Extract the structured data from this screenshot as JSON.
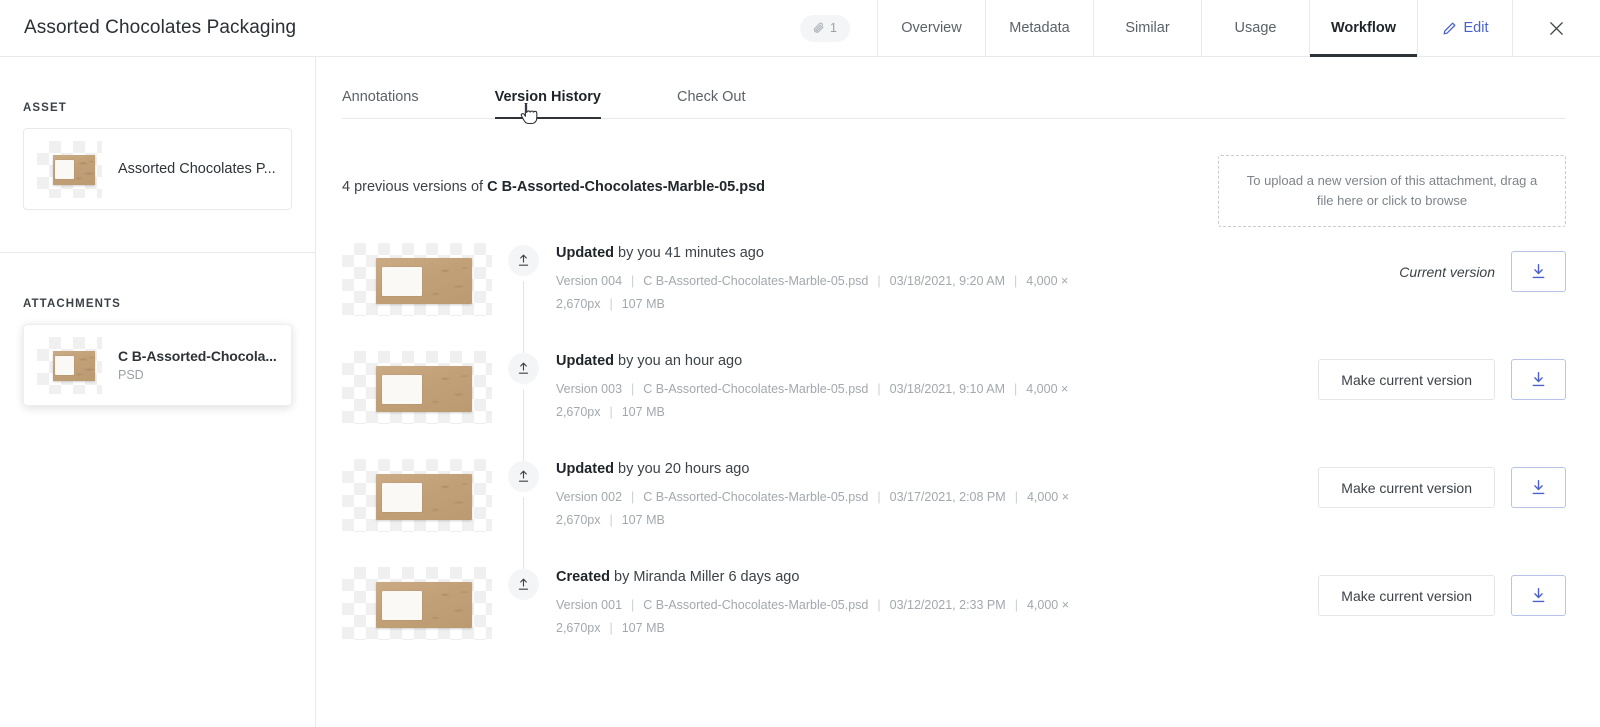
{
  "header": {
    "title": "Assorted Chocolates Packaging",
    "attachment_badge": {
      "icon": "paperclip-icon",
      "count": "1"
    },
    "tabs": [
      {
        "id": "overview",
        "label": "Overview",
        "active": false
      },
      {
        "id": "metadata",
        "label": "Metadata",
        "active": false
      },
      {
        "id": "similar",
        "label": "Similar",
        "active": false
      },
      {
        "id": "usage",
        "label": "Usage",
        "active": false
      },
      {
        "id": "workflow",
        "label": "Workflow",
        "active": true
      }
    ],
    "edit": {
      "label": "Edit",
      "icon": "pencil-icon",
      "color": "#4b63c9"
    },
    "close": {
      "icon": "close-icon"
    }
  },
  "sidebar": {
    "asset_label": "ASSET",
    "asset": {
      "name": "Assorted Chocolates P...",
      "thumbnail": "chocolate-bar-thumbnail"
    },
    "attachments_label": "ATTACHMENTS",
    "attachments": [
      {
        "name": "C B-Assorted-Chocola...",
        "type": "PSD",
        "selected": true,
        "thumbnail": "chocolate-bar-thumbnail"
      }
    ]
  },
  "main": {
    "subtabs": [
      {
        "id": "annotations",
        "label": "Annotations",
        "active": false
      },
      {
        "id": "version-history",
        "label": "Version History",
        "active": true
      },
      {
        "id": "check-out",
        "label": "Check Out",
        "active": false
      }
    ],
    "summary": {
      "prefix": "4 previous versions of ",
      "filename": "C B-Assorted-Chocolates-Marble-05.psd"
    },
    "dropzone": {
      "text": "To upload a new version of this attachment, drag a file here or click to browse"
    },
    "versions": [
      {
        "action": "Updated",
        "by": " by you 41 minutes ago",
        "version": "Version 004",
        "filename": "C B-Assorted-Chocolates-Marble-05.psd",
        "date": "03/18/2021, 9:20 AM",
        "dimensions": "4,000 × 2,670px",
        "size": "107 MB",
        "is_current": true,
        "status_label": "Current version",
        "download_label": "download-icon"
      },
      {
        "action": "Updated",
        "by": " by you an hour ago",
        "version": "Version 003",
        "filename": "C B-Assorted-Chocolates-Marble-05.psd",
        "date": "03/18/2021, 9:10 AM",
        "dimensions": "4,000 × 2,670px",
        "size": "107 MB",
        "is_current": false,
        "status_label": "Make current version",
        "download_label": "download-icon"
      },
      {
        "action": "Updated",
        "by": " by you 20 hours ago",
        "version": "Version 002",
        "filename": "C B-Assorted-Chocolates-Marble-05.psd",
        "date": "03/17/2021, 2:08 PM",
        "dimensions": "4,000 × 2,670px",
        "size": "107 MB",
        "is_current": false,
        "status_label": "Make current version",
        "download_label": "download-icon"
      },
      {
        "action": "Created",
        "by": " by Miranda Miller 6 days ago",
        "version": "Version 001",
        "filename": "C B-Assorted-Chocolates-Marble-05.psd",
        "date": "03/12/2021, 2:33 PM",
        "dimensions": "4,000 × 2,670px",
        "size": "107 MB",
        "is_current": false,
        "status_label": "Make current version",
        "download_label": "download-icon"
      }
    ],
    "separator": "|"
  },
  "colors": {
    "accent_blue": "#4b63c9",
    "border": "#e7e9ec",
    "text": "#2e3338",
    "muted": "#a2a8ad"
  }
}
